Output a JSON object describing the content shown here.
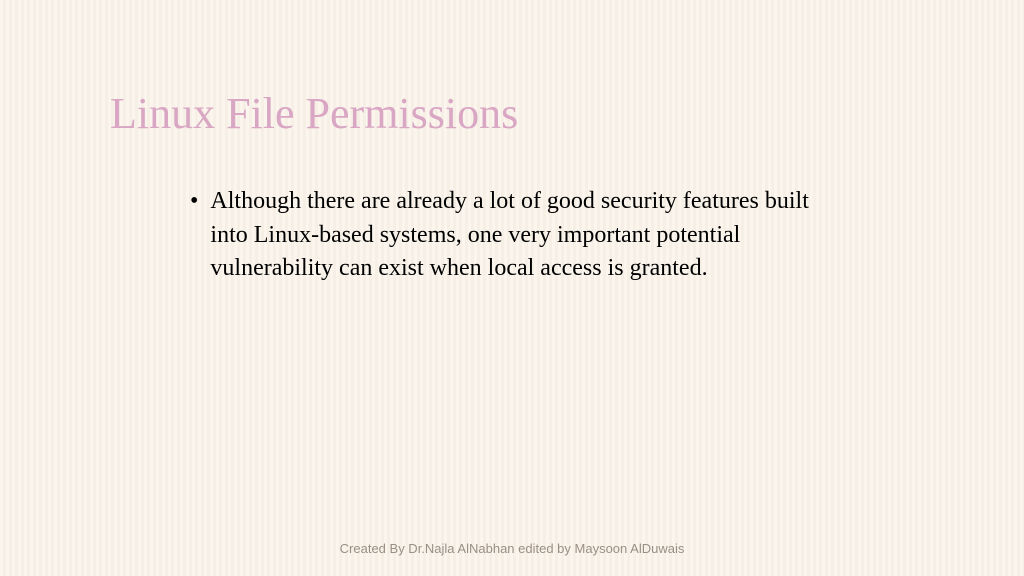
{
  "slide": {
    "title": "Linux File Permissions",
    "bullets": [
      {
        "text": "Although there are already a lot of good security features built into Linux-based systems, one very important potential vulnerability can exist when local access is granted."
      }
    ],
    "footer": "Created By Dr.Najla AlNabhan edited by Maysoon AlDuwais"
  }
}
